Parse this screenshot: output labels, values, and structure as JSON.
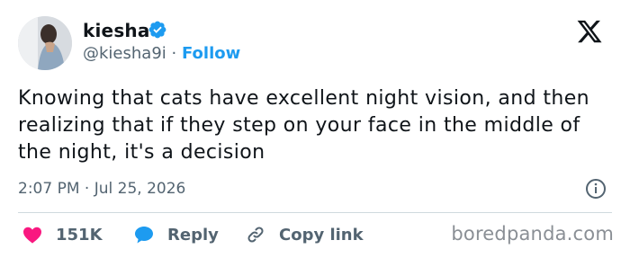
{
  "author": {
    "display_name": "kiesha",
    "handle": "@kiesha9i",
    "separator": "·",
    "follow_label": "Follow",
    "verified": true
  },
  "tweet": {
    "text": "Knowing that cats have excellent night vision, and then realizing that if they step on your face in the middle of the night, it's a decision",
    "timestamp": "2:07 PM · Jul 25, 2026"
  },
  "actions": {
    "likes_count": "151K",
    "reply_label": "Reply",
    "copy_link_label": "Copy link"
  },
  "watermark": "boredpanda.com",
  "icons": {
    "like": "heart-icon",
    "reply": "speech-bubble-icon",
    "copy": "link-icon",
    "info": "info-icon",
    "brand": "x-logo-icon",
    "verified": "verified-badge-icon"
  },
  "colors": {
    "accent": "#1d9bf0",
    "heart": "#f91880",
    "text": "#0f1419",
    "muted": "#536471"
  }
}
